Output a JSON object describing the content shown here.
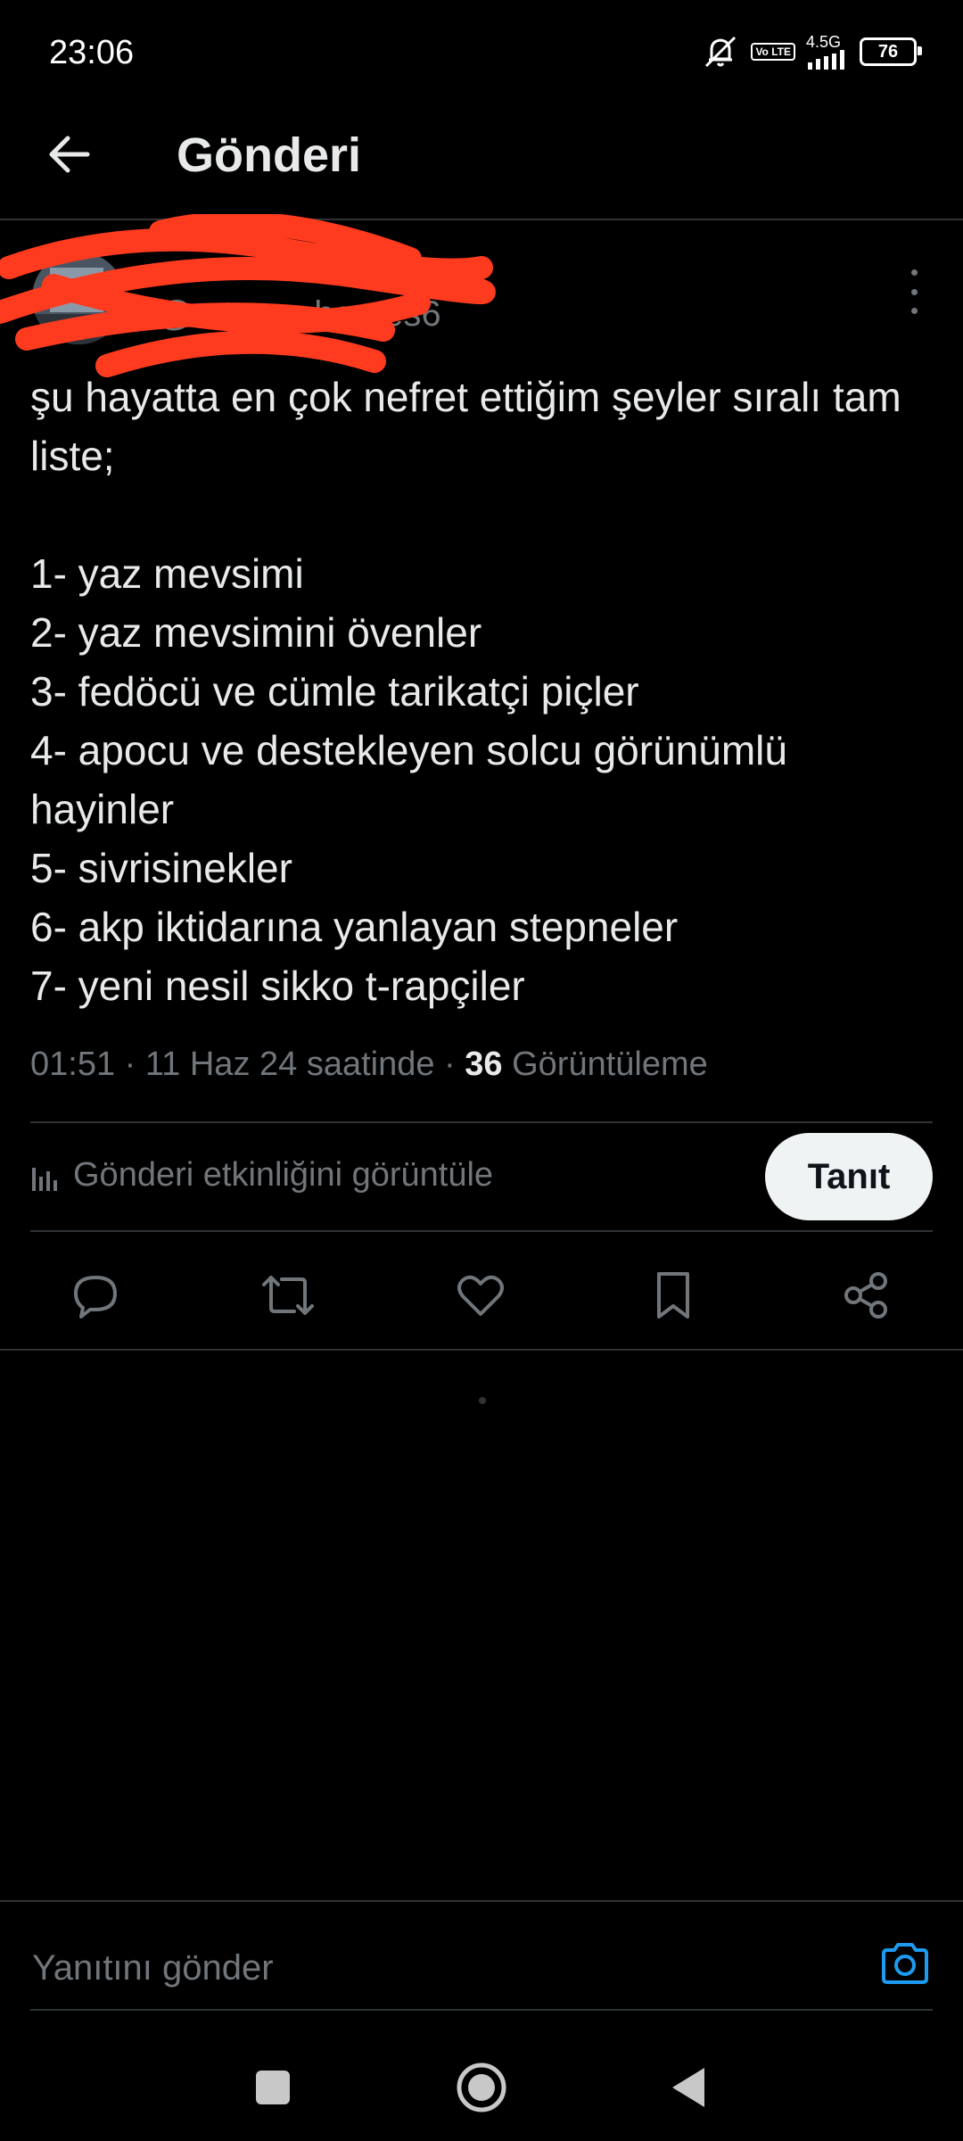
{
  "status_bar": {
    "time": "23:06",
    "volte": "Vo LTE",
    "network": "4.5G",
    "battery": "76"
  },
  "header": {
    "title": "Gönderi",
    "back_icon": "arrow-left-icon"
  },
  "post": {
    "handle": "@...tterophontes6",
    "text": "şu hayatta en çok nefret ettiğim şeyler sıralı tam liste;\n\n1- yaz mevsimi\n2- yaz mevsimini övenler\n3- fedöcü ve cümle tarikatçi piçler\n4- apocu ve destekleyen solcu görünümlü hayinler\n5- sivrisinekler\n6- akp iktidarına yanlayan stepneler\n7- yeni nesil sikko t-rapçiler",
    "time_date": "01:51 · 11 Haz 24 saatinde · ",
    "views_count": "36",
    "views_label": " Görüntüleme"
  },
  "activity": {
    "label": "Gönderi etkinliğini görüntüle",
    "promote_label": "Tanıt"
  },
  "actions": [
    "reply-icon",
    "repost-icon",
    "like-icon",
    "bookmark-icon",
    "share-icon"
  ],
  "reply": {
    "placeholder": "Yanıtını gönder"
  },
  "colors": {
    "background": "#000000",
    "text": "#e7e9ea",
    "secondary": "#71767b",
    "accent": "#1d9bf0",
    "redaction": "#ff3b1f"
  }
}
